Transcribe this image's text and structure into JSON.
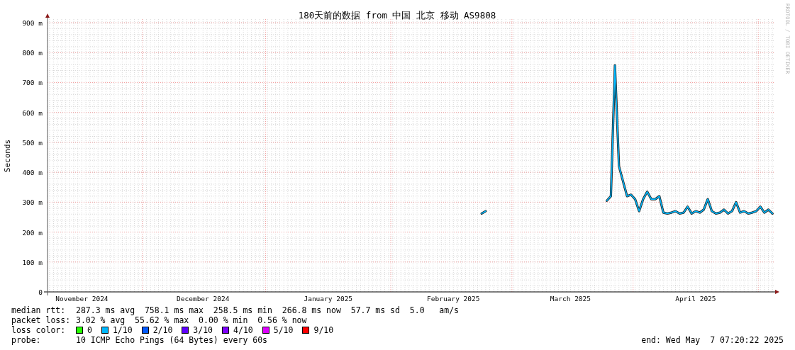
{
  "chart": {
    "chart_data": {
      "type": "line",
      "title": "180天前的数据 from 中国 北京 移动 AS9808",
      "ylabel": "Seconds",
      "ylim": [
        0,
        912
      ],
      "grid": true,
      "yticks": [
        {
          "value": 0,
          "label": "0"
        },
        {
          "value": 100,
          "label": "100 m"
        },
        {
          "value": 200,
          "label": "200 m"
        },
        {
          "value": 300,
          "label": "300 m"
        },
        {
          "value": 400,
          "label": "400 m"
        },
        {
          "value": 500,
          "label": "500 m"
        },
        {
          "value": 600,
          "label": "600 m"
        },
        {
          "value": 700,
          "label": "700 m"
        },
        {
          "value": 800,
          "label": "800 m"
        },
        {
          "value": 900,
          "label": "900 m"
        }
      ],
      "categories": [
        null,
        null,
        null,
        null,
        null,
        null,
        null,
        null,
        "November 2024",
        null,
        null,
        null,
        null,
        null,
        null,
        null,
        null,
        null,
        null,
        null,
        null,
        null,
        null,
        null,
        null,
        null,
        null,
        null,
        null,
        null,
        null,
        null,
        null,
        null,
        null,
        null,
        null,
        null,
        "December 2024",
        null,
        null,
        null,
        null,
        null,
        null,
        null,
        null,
        null,
        null,
        null,
        null,
        null,
        null,
        null,
        null,
        null,
        null,
        null,
        null,
        null,
        null,
        null,
        null,
        null,
        null,
        null,
        null,
        null,
        null,
        "January 2025",
        null,
        null,
        null,
        null,
        null,
        null,
        null,
        null,
        null,
        null,
        null,
        null,
        null,
        null,
        null,
        null,
        null,
        null,
        null,
        null,
        null,
        null,
        null,
        null,
        null,
        null,
        null,
        null,
        null,
        null,
        "February 2025",
        null,
        null,
        null,
        null,
        null,
        null,
        null,
        null,
        null,
        null,
        null,
        null,
        null,
        null,
        null,
        null,
        null,
        null,
        null,
        null,
        null,
        null,
        null,
        null,
        null,
        null,
        null,
        null,
        "March 2025",
        null,
        null,
        null,
        null,
        null,
        null,
        null,
        null,
        null,
        null,
        null,
        null,
        null,
        null,
        null,
        null,
        null,
        null,
        null,
        null,
        null,
        null,
        null,
        null,
        null,
        null,
        null,
        null,
        null,
        null,
        "April 2025",
        null,
        null,
        null,
        null,
        null,
        null,
        null,
        null,
        null,
        null,
        null,
        null,
        null,
        null,
        null,
        null,
        null,
        null,
        null
      ],
      "series": [
        {
          "color": "#00b8ff",
          "values": [
            null,
            null,
            null,
            null,
            null,
            null,
            null,
            null,
            null,
            null,
            null,
            null,
            null,
            null,
            null,
            null,
            null,
            null,
            null,
            null,
            null,
            null,
            null,
            null,
            null,
            null,
            null,
            null,
            null,
            null,
            null,
            null,
            null,
            null,
            null,
            null,
            null,
            null,
            null,
            null,
            null,
            null,
            null,
            null,
            null,
            null,
            null,
            null,
            null,
            null,
            null,
            null,
            null,
            null,
            null,
            null,
            null,
            null,
            null,
            null,
            null,
            null,
            null,
            null,
            null,
            null,
            null,
            null,
            null,
            null,
            null,
            null,
            null,
            null,
            null,
            null,
            null,
            null,
            null,
            null,
            null,
            null,
            null,
            null,
            null,
            null,
            null,
            null,
            null,
            null,
            null,
            null,
            null,
            null,
            null,
            null,
            null,
            null,
            null,
            null,
            null,
            null,
            null,
            null,
            null,
            null,
            null,
            262,
            270,
            null,
            null,
            null,
            null,
            null,
            null,
            null,
            null,
            null,
            null,
            null,
            null,
            null,
            null,
            null,
            null,
            null,
            null,
            null,
            null,
            null,
            null,
            null,
            null,
            null,
            null,
            null,
            null,
            null,
            305,
            320,
            758,
            420,
            370,
            320,
            325,
            310,
            270,
            310,
            335,
            310,
            310,
            320,
            265,
            262,
            265,
            270,
            262,
            265,
            285,
            262,
            270,
            265,
            275,
            310,
            270,
            262,
            265,
            275,
            262,
            270,
            300,
            265,
            270,
            262,
            265,
            270,
            285,
            265,
            275,
            262
          ]
        }
      ]
    }
  },
  "legend": {
    "median_rtt": {
      "label": "median rtt:",
      "text": "287.3 ms avg  758.1 ms max  258.5 ms min  266.8 ms now  57.7 ms sd  5.0   am/s"
    },
    "packet_loss": {
      "label": "packet loss:",
      "text": "3.02 % avg  55.62 % max  0.00 % min  0.56 % now"
    },
    "loss_color": {
      "label": "loss color:",
      "items": [
        {
          "label": "0",
          "color": "#26ff00"
        },
        {
          "label": "1/10",
          "color": "#00b8ff"
        },
        {
          "label": "2/10",
          "color": "#0059ff"
        },
        {
          "label": "3/10",
          "color": "#5e00ff"
        },
        {
          "label": "4/10",
          "color": "#7e00ff"
        },
        {
          "label": "5/10",
          "color": "#dd00ff"
        },
        {
          "label": "9/10",
          "color": "#ff0000"
        }
      ]
    },
    "probe": {
      "label": "probe:",
      "text": "10 ICMP Echo Pings (64 Bytes) every 60s"
    },
    "end": "end: Wed May  7 07:20:22 2025"
  },
  "watermark": "RRDTOOL / TOBI OETIKER"
}
